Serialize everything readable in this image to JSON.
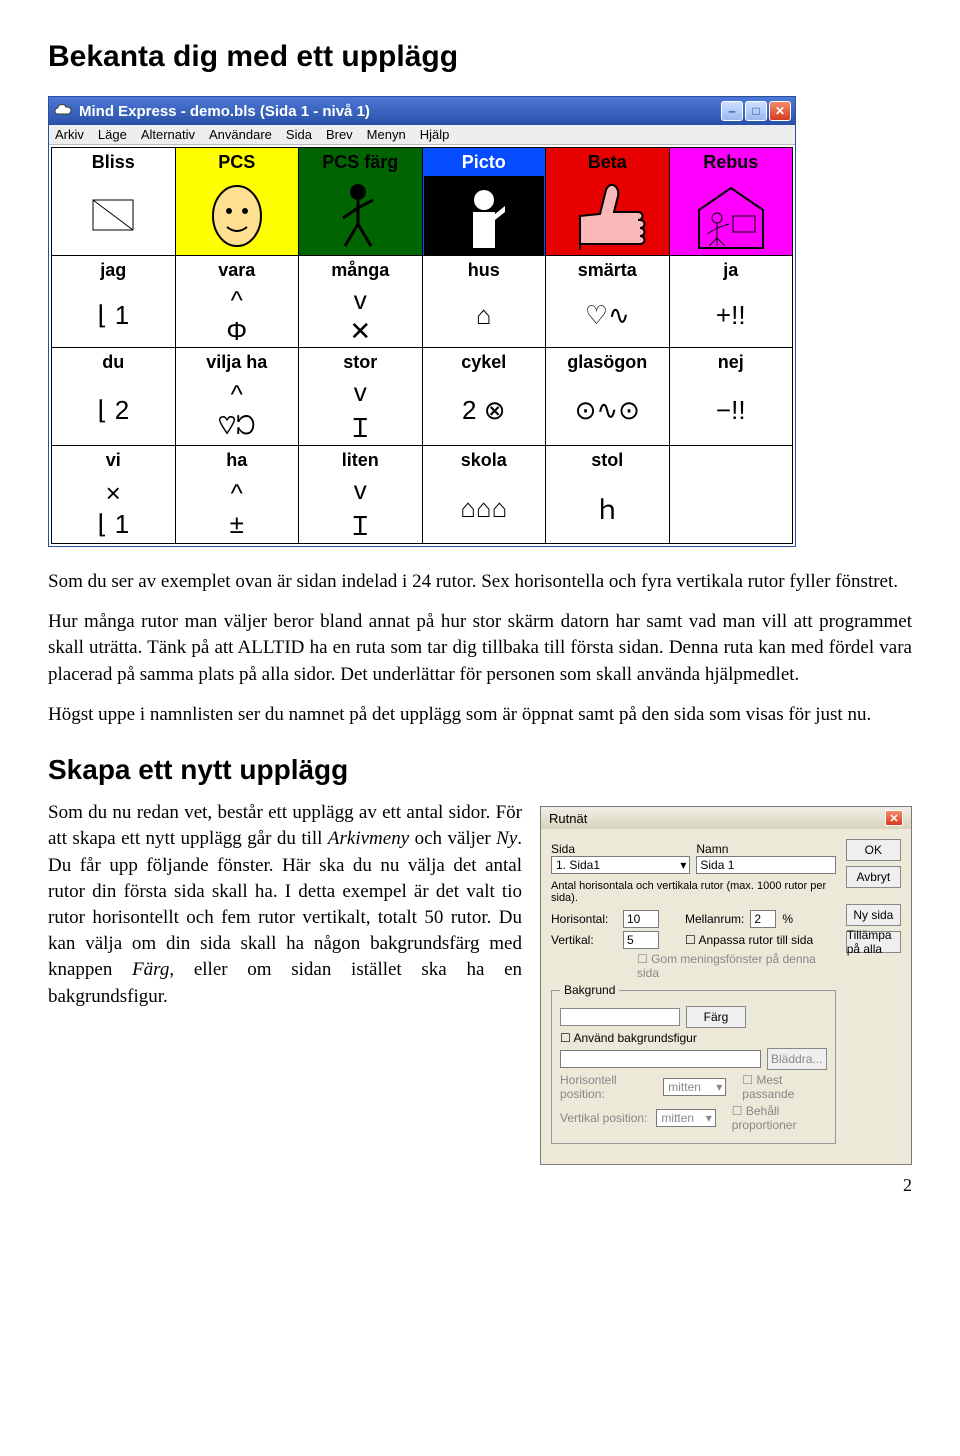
{
  "headings": {
    "h1": "Bekanta dig med ett upplägg",
    "h2": "Skapa ett nytt upplägg"
  },
  "paragraphs": {
    "p1": "Som du ser av exemplet ovan är sidan indelad i 24 rutor. Sex horisontella och fyra vertikala rutor fyller fönstret.",
    "p2": "Hur många rutor man väljer beror bland annat på hur stor skärm datorn har samt vad man vill att programmet skall uträtta. Tänk på att ALLTID ha en ruta som tar dig tillbaka till första sidan. Denna ruta kan med fördel vara placerad på samma plats på alla sidor. Det underlättar för personen som skall använda hjälpmedlet.",
    "p3": "Högst uppe i namnlisten ser du namnet på det upplägg som är öppnat samt på den sida som visas för just nu.",
    "p4a": "Som du nu redan vet, består ett upplägg av ett antal sidor. För att skapa ett nytt upplägg går du till ",
    "p4b": " och väljer ",
    "p4c": ". Du får upp följande fönster. Här ska du nu välja det antal rutor din första sida skall ha. I detta exempel är det valt tio rutor horisontellt och fem rutor vertikalt, totalt 50 rutor. Du kan välja om din sida skall ha någon bakgrundsfärg med knappen ",
    "p4d": ", eller om sidan istället ska ha en bakgrundsfigur.",
    "em_arkivmeny": "Arkivmeny",
    "em_ny": "Ny",
    "em_farg": "Färg"
  },
  "window": {
    "title": "Mind Express - demo.bls (Sida 1 - nivå 1)",
    "menu": [
      "Arkiv",
      "Läge",
      "Alternativ",
      "Användare",
      "Sida",
      "Brev",
      "Menyn",
      "Hjälp"
    ]
  },
  "grid": {
    "headers": [
      {
        "label": "Bliss",
        "bg": "bg-white",
        "icon": ""
      },
      {
        "label": "PCS",
        "bg": "bg-yellow",
        "icon": "face"
      },
      {
        "label": "PCS färg",
        "bg": "bg-green",
        "icon": "walk"
      },
      {
        "label": "Picto",
        "bg": "bg-blue",
        "icon": "speak"
      },
      {
        "label": "Beta",
        "bg": "bg-red",
        "icon": "thumb"
      },
      {
        "label": "Rebus",
        "bg": "bg-mag",
        "icon": "house"
      }
    ],
    "rows": [
      [
        {
          "label": "jag",
          "sym": "⌊ 1"
        },
        {
          "label": "vara",
          "sym": "^\nΦ"
        },
        {
          "label": "många",
          "sym": "v\n✕"
        },
        {
          "label": "hus",
          "sym": "⌂"
        },
        {
          "label": "smärta",
          "sym": "♡∿"
        },
        {
          "label": "ja",
          "sym": "+!!"
        }
      ],
      [
        {
          "label": "du",
          "sym": "⌊ 2"
        },
        {
          "label": "vilja ha",
          "sym": "^\n♡ᘰ"
        },
        {
          "label": "stor",
          "sym": "v\nＩ"
        },
        {
          "label": "cykel",
          "sym": "2 ⊗"
        },
        {
          "label": "glasögon",
          "sym": "⊙∿⊙"
        },
        {
          "label": "nej",
          "sym": "−!!"
        }
      ],
      [
        {
          "label": "vi",
          "sym": "×\n⌊ 1"
        },
        {
          "label": "ha",
          "sym": "^\n±"
        },
        {
          "label": "liten",
          "sym": "v\nＩ"
        },
        {
          "label": "skola",
          "sym": "⌂⌂⌂"
        },
        {
          "label": "stol",
          "sym": "ｈ"
        },
        {
          "label": "",
          "sym": ""
        }
      ]
    ]
  },
  "dialog": {
    "title": "Rutnät",
    "buttons": {
      "ok": "OK",
      "cancel": "Avbryt",
      "newpage": "Ny sida",
      "applyall": "Tillämpa på alla",
      "browse": "Bläddra..."
    },
    "labels": {
      "sida": "Sida",
      "namn": "Namn",
      "sida_val": "1. Sida1",
      "namn_val": "Sida 1",
      "hint": "Antal horisontala och vertikala rutor (max. 1000 rutor per sida).",
      "hor": "Horisontal:",
      "ver": "Vertikal:",
      "hor_val": "10",
      "ver_val": "5",
      "space": "Mellanrum:",
      "space_val": "2",
      "pct": "%",
      "fit": "Anpassa rutor till sida",
      "samewin": "Gom meningsfönster på denna sida",
      "bg_legend": "Bakgrund",
      "color_btn": "Färg",
      "usebg": "Använd bakgrundsfigur",
      "hpos": "Horisontell position:",
      "vpos": "Vertikal position:",
      "center": "mitten",
      "bestfit": "Mest passande",
      "keep": "Behåll proportioner"
    }
  },
  "page_number": "2"
}
